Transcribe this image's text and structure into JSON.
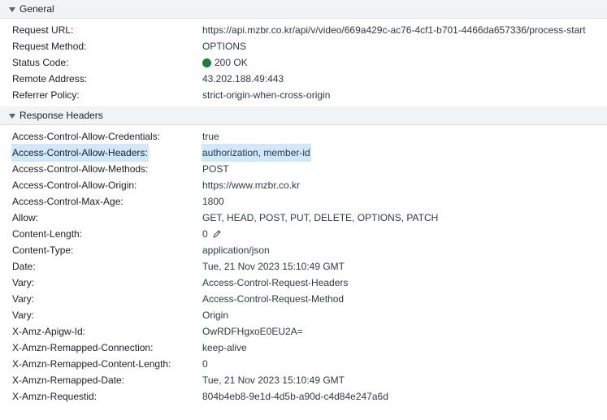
{
  "general": {
    "title": "General",
    "rows": {
      "request_url": {
        "key": "Request URL:",
        "value": "https://api.mzbr.co.kr/api/v/video/669a429c-ac76-4cf1-b701-4466da657336/process-start"
      },
      "request_method": {
        "key": "Request Method:",
        "value": "OPTIONS"
      },
      "status_code": {
        "key": "Status Code:",
        "value": "200 OK",
        "status_color": "#188038"
      },
      "remote_address": {
        "key": "Remote Address:",
        "value": "43.202.188.49:443"
      },
      "referrer_policy": {
        "key": "Referrer Policy:",
        "value": "strict-origin-when-cross-origin"
      }
    }
  },
  "response_headers": {
    "title": "Response Headers",
    "rows": [
      {
        "key": "Access-Control-Allow-Credentials:",
        "value": "true"
      },
      {
        "key": "Access-Control-Allow-Headers:",
        "value": "authorization, member-id"
      },
      {
        "key": "Access-Control-Allow-Methods:",
        "value": "POST"
      },
      {
        "key": "Access-Control-Allow-Origin:",
        "value": "https://www.mzbr.co.kr"
      },
      {
        "key": "Access-Control-Max-Age:",
        "value": "1800"
      },
      {
        "key": "Allow:",
        "value": "GET, HEAD, POST, PUT, DELETE, OPTIONS, PATCH"
      },
      {
        "key": "Content-Length:",
        "value": "0"
      },
      {
        "key": "Content-Type:",
        "value": "application/json"
      },
      {
        "key": "Date:",
        "value": "Tue, 21 Nov 2023 15:10:49 GMT"
      },
      {
        "key": "Vary:",
        "value": "Access-Control-Request-Headers"
      },
      {
        "key": "Vary:",
        "value": "Access-Control-Request-Method"
      },
      {
        "key": "Vary:",
        "value": "Origin"
      },
      {
        "key": "X-Amz-Apigw-Id:",
        "value": "OwRDFHgxoE0EU2A="
      },
      {
        "key": "X-Amzn-Remapped-Connection:",
        "value": "keep-alive"
      },
      {
        "key": "X-Amzn-Remapped-Content-Length:",
        "value": "0"
      },
      {
        "key": "X-Amzn-Remapped-Date:",
        "value": "Tue, 21 Nov 2023 15:10:49 GMT"
      },
      {
        "key": "X-Amzn-Requestid:",
        "value": "804b4eb8-9e1d-4d5b-a90d-c4d84e247a6d"
      }
    ]
  },
  "colors": {
    "highlight": "#cfe8fc",
    "header_bg": "#f1f3f4"
  },
  "icons": {
    "section_toggle": "triangle-down-icon",
    "edit": "pencil-icon",
    "status": "status-dot-icon"
  }
}
